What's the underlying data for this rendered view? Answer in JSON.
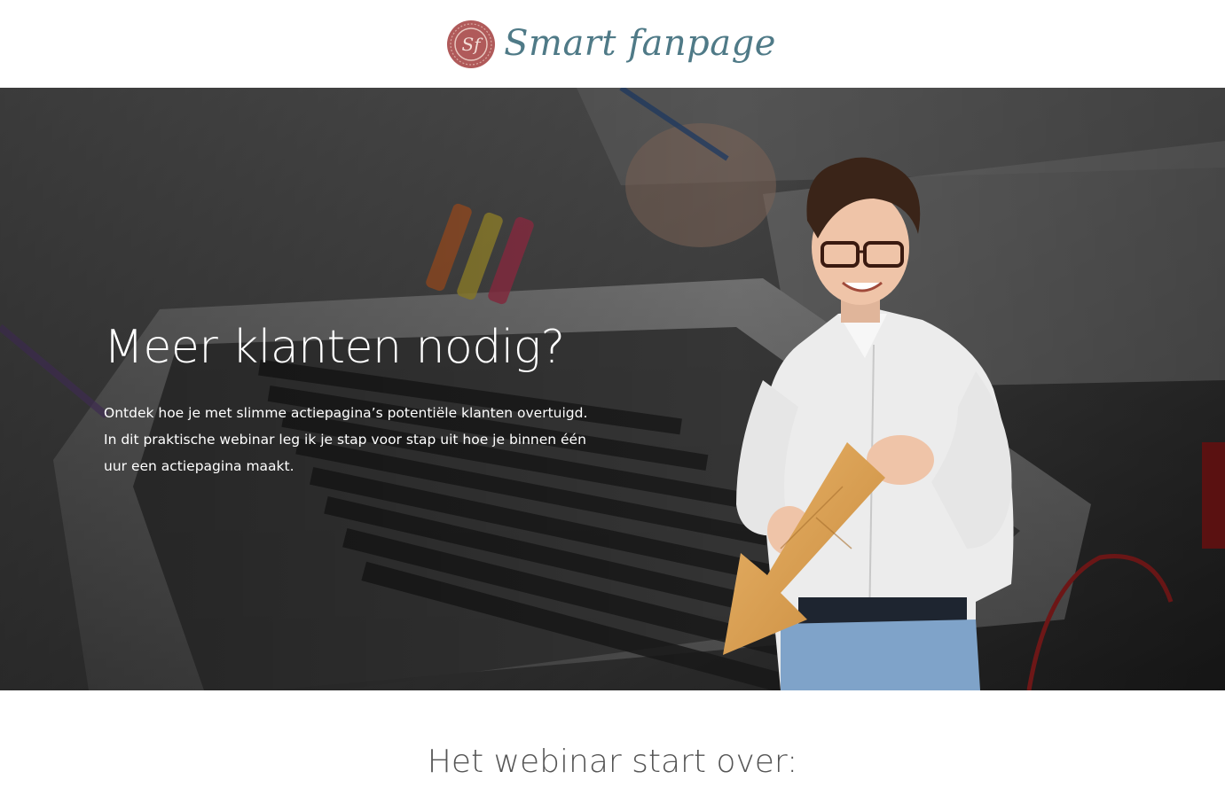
{
  "header": {
    "logo_text": "Smart fanpage",
    "logo_badge_text": "Sf",
    "logo_badge_color": "#b05a5a",
    "logo_text_color": "#4f7a87"
  },
  "hero": {
    "title": "Meer klanten nodig?",
    "description": "Ontdek hoe je met slimme actiepagina’s potentiële klanten overtuigd. In dit praktische webinar leg ik je stap voor stap uit hoe je binnen één uur een actiepagina maakt."
  },
  "countdown": {
    "title": "Het webinar start over:"
  }
}
